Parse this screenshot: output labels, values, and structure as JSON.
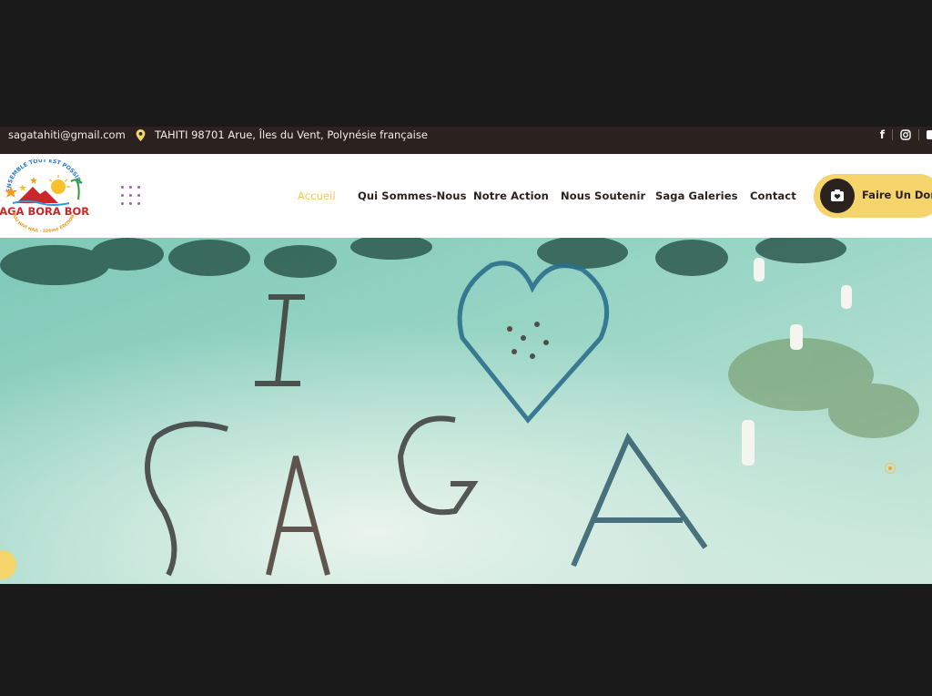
{
  "topbar": {
    "email": "sagatahiti@gmail.com",
    "address": "TAHITI 98701 Arue, Îles du Vent, Polynésie française",
    "social": [
      "facebook-icon",
      "instagram-icon"
    ]
  },
  "header": {
    "logo_text": "SAGA BORA BORA",
    "logo_arc_text": "ENSEMBLE TOUT EST POSSIBLE !",
    "logo_sub_text": "NUU HIVI HAA · 32ème EDITION",
    "nav": [
      "Accueil",
      "Qui Sommes-Nous",
      "Notre Action",
      "Nous Soutenir",
      "Saga Galeries",
      "Contact"
    ],
    "active_nav": "Accueil",
    "donate_label": "Faire Un Don"
  },
  "hero": {
    "image_icon": "aerial-lagoon-photo",
    "slider_dots": 1
  },
  "colors": {
    "accent": "#f4d46b",
    "dark": "#2b2220",
    "active_nav": "#f2c94c",
    "dots": "#a85db0"
  }
}
